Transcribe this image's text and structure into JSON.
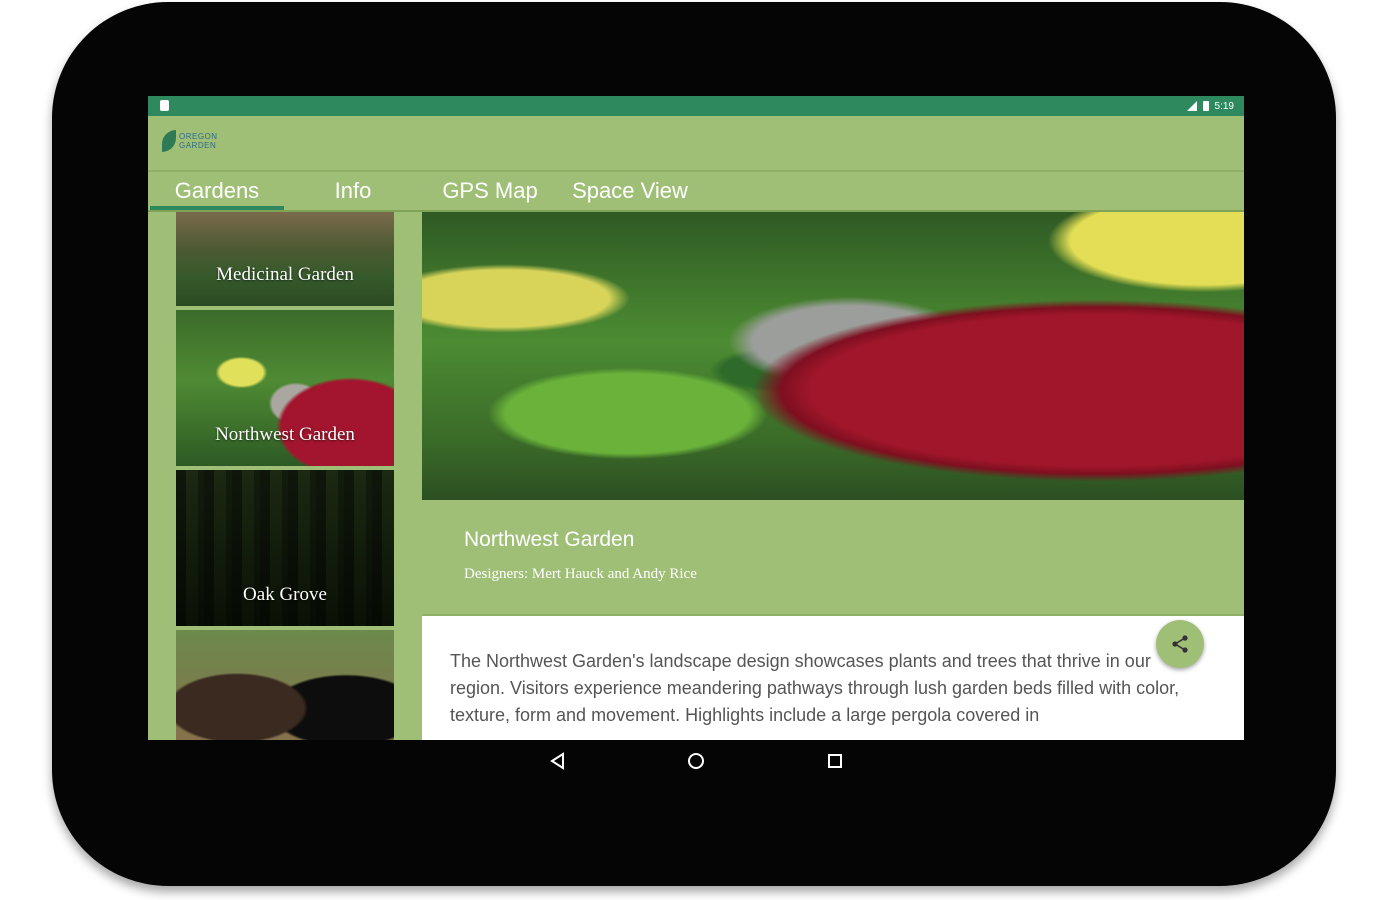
{
  "status_bar": {
    "time": "5:19"
  },
  "app_bar": {
    "logo_line1": "OREGON",
    "logo_line2": "GARDEN"
  },
  "tabs": [
    {
      "label": "Gardens",
      "active": true
    },
    {
      "label": "Info",
      "active": false
    },
    {
      "label": "GPS Map",
      "active": false
    },
    {
      "label": "Space View",
      "active": false
    }
  ],
  "garden_list": [
    {
      "label": "Medicinal Garden"
    },
    {
      "label": "Northwest Garden"
    },
    {
      "label": "Oak Grove"
    }
  ],
  "detail": {
    "title": "Northwest Garden",
    "designers": "Designers: Mert Hauck and Andy Rice",
    "description": "The Northwest Garden's landscape design showcases plants and trees that thrive in our region. Visitors experience meandering pathways through lush garden beds filled with color, texture, form and movement. Highlights include a large pergola covered in"
  },
  "icons": {
    "share": "share-icon",
    "back": "back-triangle-icon",
    "home": "home-circle-icon",
    "recents": "recents-square-icon"
  },
  "colors": {
    "primary": "#9fbf77",
    "status_bar": "#2e8a5e",
    "device": "#050505"
  }
}
